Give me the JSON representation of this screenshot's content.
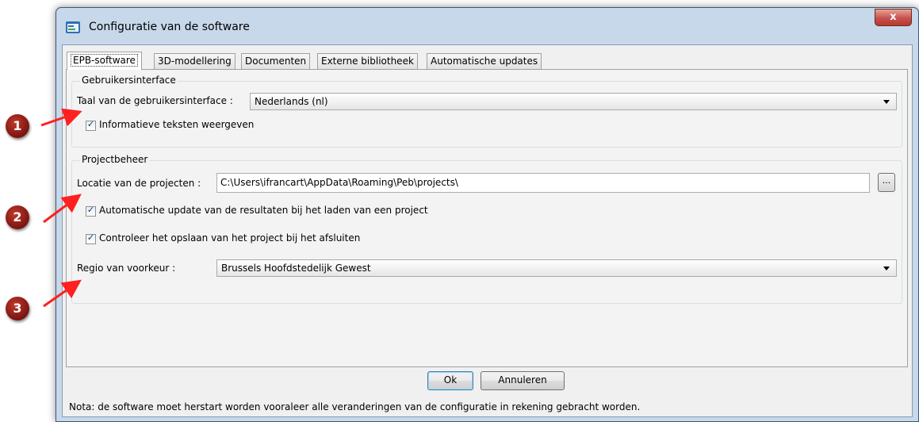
{
  "window": {
    "title": "Configuratie van de software",
    "close_label": "x"
  },
  "tabs": [
    {
      "label": "EPB-software",
      "active": true
    },
    {
      "label": "3D-modellering",
      "active": false
    },
    {
      "label": "Documenten",
      "active": false
    },
    {
      "label": "Externe bibliotheek",
      "active": false
    },
    {
      "label": "Automatische updates",
      "active": false
    }
  ],
  "ui_group": {
    "title": "Gebruikersinterface",
    "language_label": "Taal van de gebruikersinterface :",
    "language_value": "Nederlands (nl)",
    "info_texts_label": "Informatieve teksten weergeven",
    "info_texts_checked": true
  },
  "project_group": {
    "title": "Projectbeheer",
    "location_label": "Locatie van de projecten :",
    "location_value": "C:\\Users\\ifrancart\\AppData\\Roaming\\Peb\\projects\\",
    "browse_label": "...",
    "auto_update_label": "Automatische update van de resultaten bij het laden van een project",
    "auto_update_checked": true,
    "check_save_label": "Controleer het opslaan van het project bij het afsluiten",
    "check_save_checked": true,
    "region_label": "Regio van voorkeur :",
    "region_value": "Brussels Hoofdstedelijk Gewest"
  },
  "buttons": {
    "ok": "Ok",
    "cancel": "Annuleren"
  },
  "note": "Nota: de software moet herstart worden vooraleer alle veranderingen van de configuratie in rekening gebracht worden.",
  "annotations": [
    "1",
    "2",
    "3"
  ],
  "colors": {
    "marker": "#8b1a14",
    "arrow": "#ff2020",
    "accent": "#3c7fb1"
  }
}
